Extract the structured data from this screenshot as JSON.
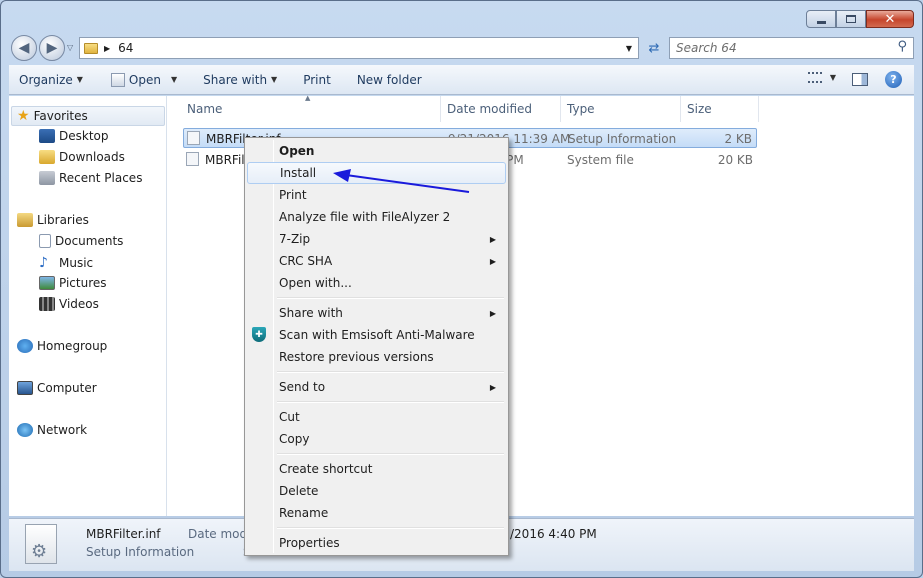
{
  "address": {
    "folder": "64"
  },
  "search": {
    "placeholder": "Search 64"
  },
  "toolbar": {
    "organize": "Organize",
    "open": "Open",
    "share_with": "Share with",
    "print": "Print",
    "new_folder": "New folder"
  },
  "nav": {
    "favorites": "Favorites",
    "desktop": "Desktop",
    "downloads": "Downloads",
    "recent_places": "Recent Places",
    "libraries": "Libraries",
    "documents": "Documents",
    "music": "Music",
    "pictures": "Pictures",
    "videos": "Videos",
    "homegroup": "Homegroup",
    "computer": "Computer",
    "network": "Network"
  },
  "columns": {
    "name": "Name",
    "date_modified": "Date modified",
    "type": "Type",
    "size": "Size"
  },
  "files": [
    {
      "name": "MBRFilter.inf",
      "date": "9/21/2016 11:39 AM",
      "type": "Setup Information",
      "size": "2 KB"
    },
    {
      "name": "MBRFil",
      "date": "01 PM",
      "type": "System file",
      "size": "20 KB"
    }
  ],
  "context_menu": {
    "open": "Open",
    "install": "Install",
    "print": "Print",
    "analyze": "Analyze file with FileAlyzer 2",
    "zip": "7-Zip",
    "crc": "CRC SHA",
    "open_with": "Open with...",
    "share_with": "Share with",
    "scan": "Scan with Emsisoft Anti-Malware",
    "restore": "Restore previous versions",
    "send_to": "Send to",
    "cut": "Cut",
    "copy": "Copy",
    "create_shortcut": "Create shortcut",
    "delete": "Delete",
    "rename": "Rename",
    "properties": "Properties"
  },
  "details": {
    "filename": "MBRFilter.inf",
    "type": "Setup Information",
    "date_label": "Date modi",
    "date_value": "/2016 4:40 PM",
    "size_label": "S"
  }
}
